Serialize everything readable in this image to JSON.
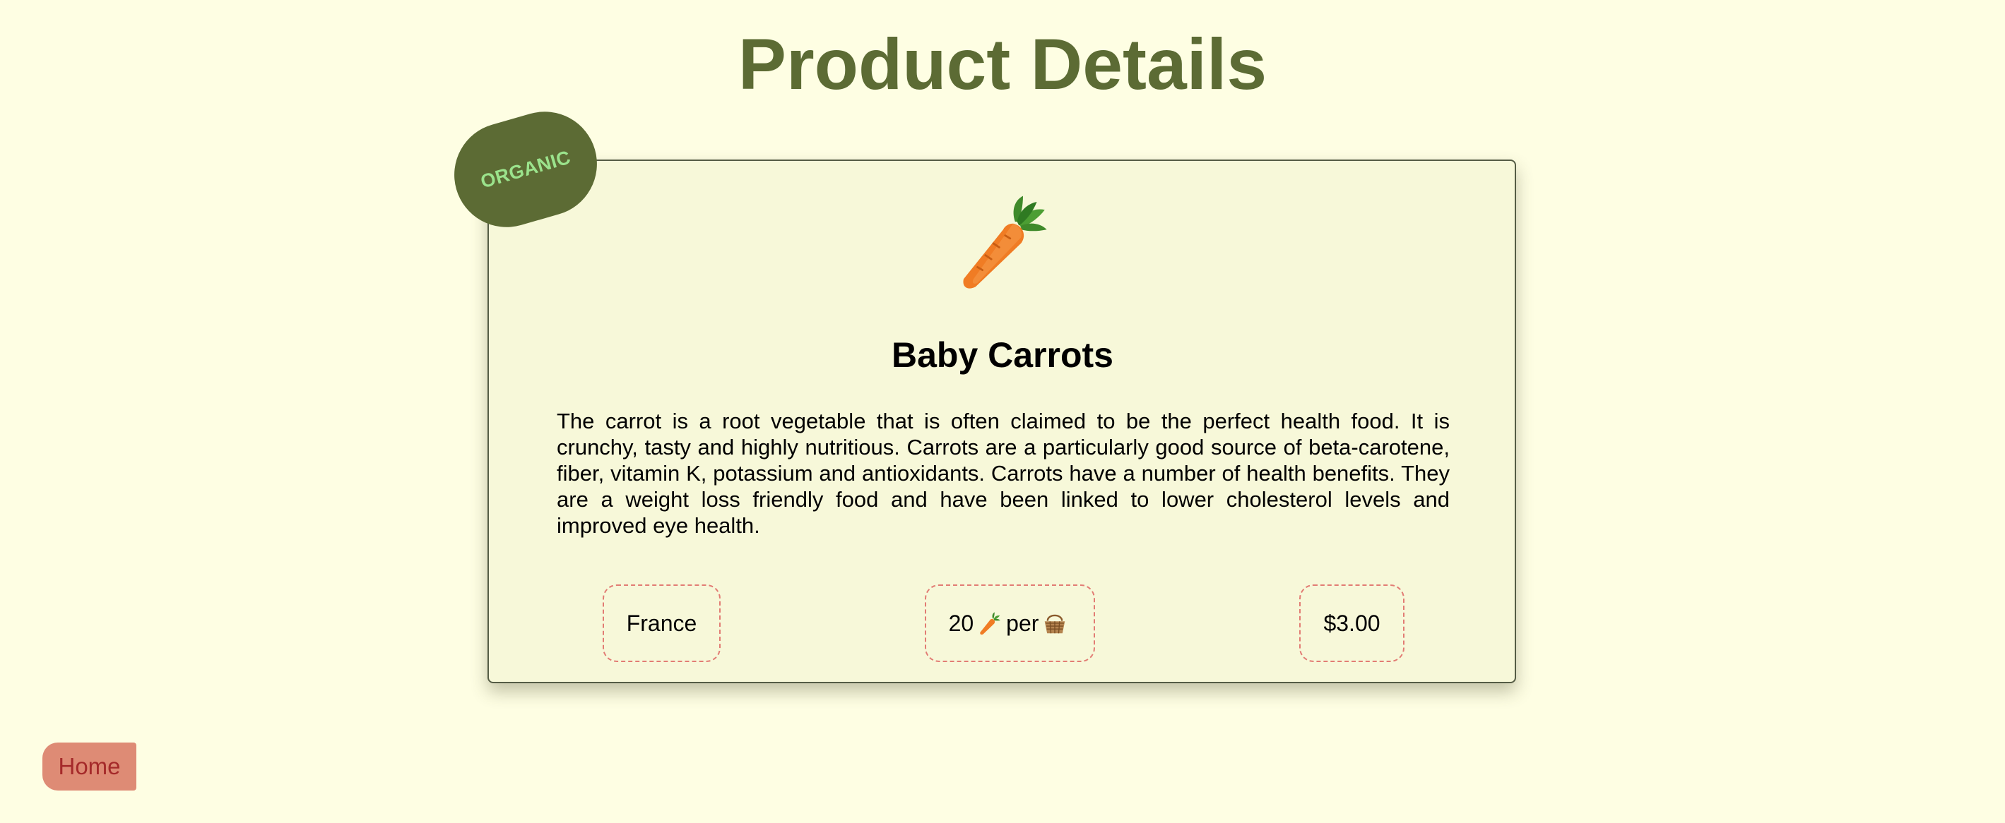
{
  "header": {
    "title": "Product Details"
  },
  "badge": {
    "label": "ORGANIC"
  },
  "product": {
    "icon": "carrot-icon",
    "name": "Baby Carrots",
    "description": "The carrot is a root vegetable that is often claimed to be the perfect health food. It is crunchy, tasty and highly nutritious. Carrots are a particularly good source of beta-carotene, fiber, vitamin K, potassium and antioxidants. Carrots have a number of health benefits. They are a weight loss friendly food and have been linked to lower cholesterol levels and improved eye health.",
    "origin": "France",
    "quantity": {
      "count": "20",
      "unit_icon": "carrot-icon",
      "per_label": "per",
      "container_icon": "basket-icon"
    },
    "price": "$3.00"
  },
  "nav": {
    "home_label": "Home"
  },
  "colors": {
    "background": "#fefee3",
    "title": "#5c6b34",
    "card_background": "#f7f8d9",
    "badge_background": "#5c6b34",
    "badge_text": "#9be38c",
    "info_border": "#e27c74",
    "home_button_background": "#de8b75",
    "home_button_text": "#a52a2a"
  }
}
